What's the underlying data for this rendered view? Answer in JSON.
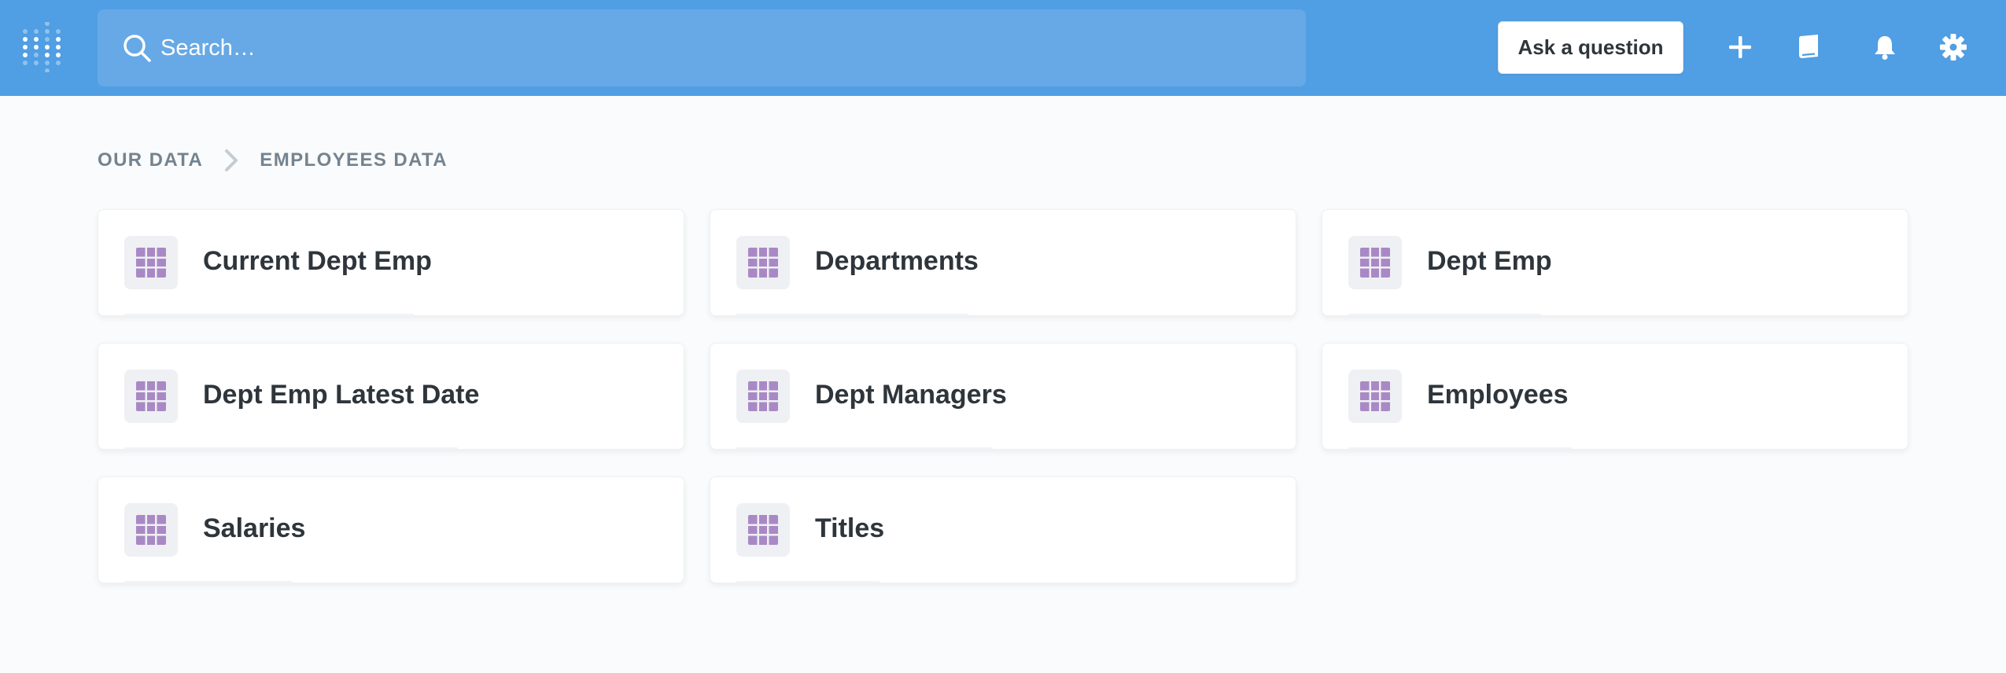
{
  "header": {
    "search_placeholder": "Search…",
    "ask_button_label": "Ask a question",
    "icons": [
      "logo-icon",
      "search-icon",
      "plus-icon",
      "book-icon",
      "bell-icon",
      "gear-icon"
    ],
    "colors": {
      "navbar": "#509ee3",
      "search": "#66a9e6",
      "table_icon": "#a989c5"
    }
  },
  "breadcrumb": {
    "root": "OUR DATA",
    "current": "EMPLOYEES DATA"
  },
  "tables": [
    {
      "label": "Current Dept Emp"
    },
    {
      "label": "Departments"
    },
    {
      "label": "Dept Emp"
    },
    {
      "label": "Dept Emp Latest Date"
    },
    {
      "label": "Dept Managers"
    },
    {
      "label": "Employees"
    },
    {
      "label": "Salaries"
    },
    {
      "label": "Titles"
    }
  ]
}
